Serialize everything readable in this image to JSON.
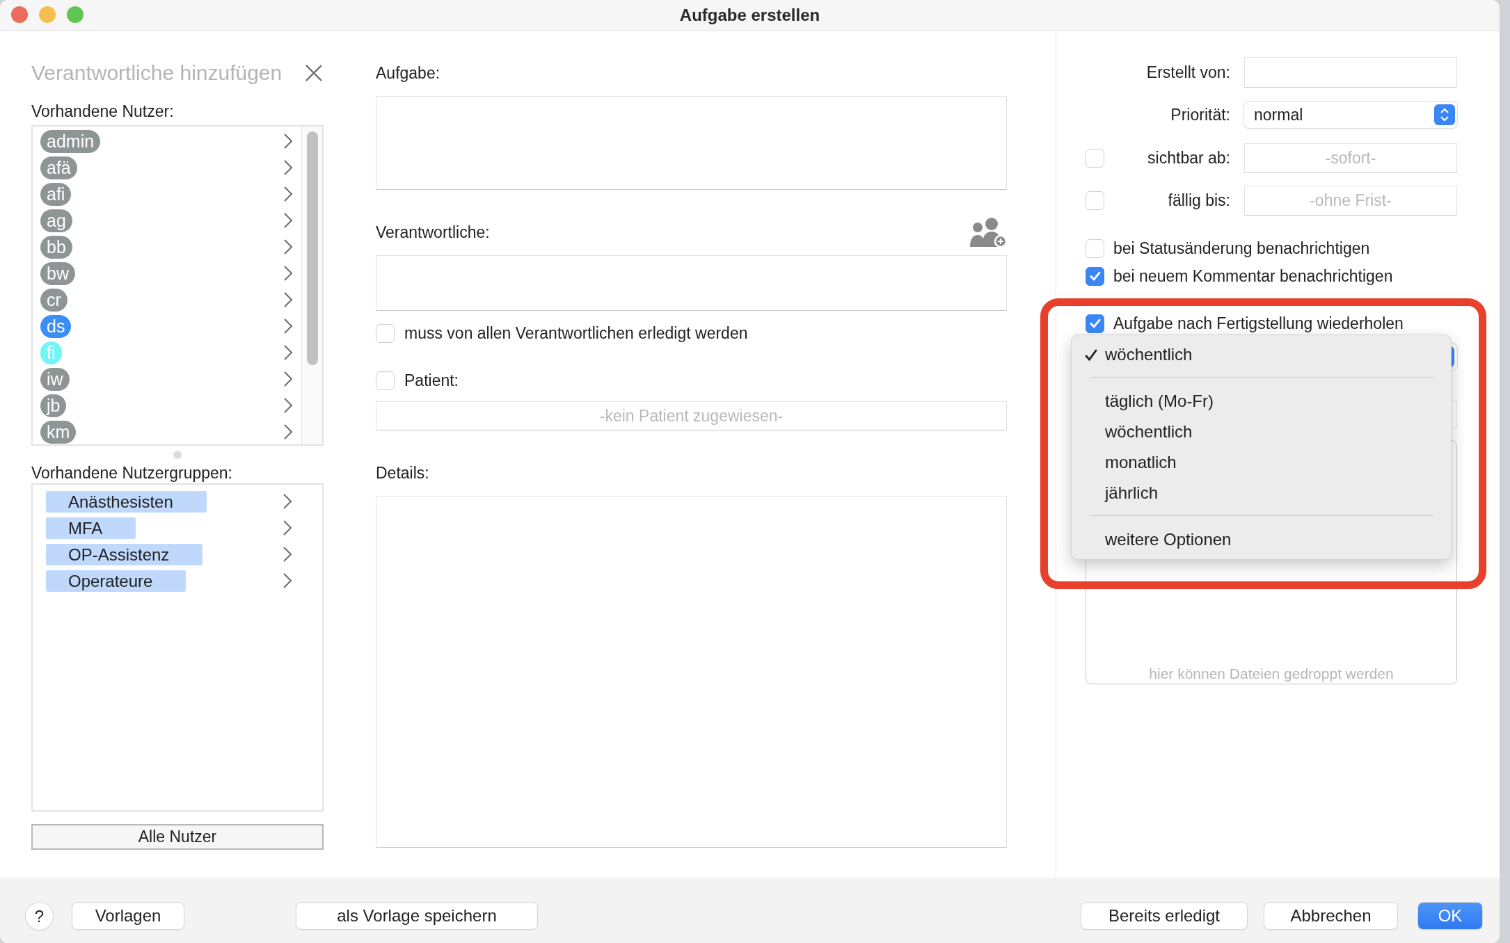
{
  "window": {
    "title": "Aufgabe erstellen"
  },
  "assignee_picker": {
    "title": "Verantwortliche hinzufügen",
    "users_label": "Vorhandene Nutzer:",
    "users": [
      {
        "name": "admin",
        "color": "#8e9595"
      },
      {
        "name": "afä",
        "color": "#8e9595"
      },
      {
        "name": "afi",
        "color": "#8e9595"
      },
      {
        "name": "ag",
        "color": "#8e9595"
      },
      {
        "name": "bb",
        "color": "#8e9595"
      },
      {
        "name": "bw",
        "color": "#8e9595"
      },
      {
        "name": "cr",
        "color": "#8e9595"
      },
      {
        "name": "ds",
        "color": "#3d8ef2"
      },
      {
        "name": "fi",
        "color": "#72f5f7"
      },
      {
        "name": "iw",
        "color": "#8e9595"
      },
      {
        "name": "jb",
        "color": "#8e9595"
      },
      {
        "name": "km",
        "color": "#8e9595"
      }
    ],
    "groups_label": "Vorhandene Nutzergruppen:",
    "groups": [
      {
        "name": "Anästhesisten"
      },
      {
        "name": "MFA"
      },
      {
        "name": "OP-Assistenz"
      },
      {
        "name": "Operateure"
      }
    ],
    "all_users_button": "Alle Nutzer"
  },
  "task_form": {
    "task_label": "Aufgabe:",
    "assignees_label": "Verantwortliche:",
    "all_must_complete": {
      "label": "muss von allen Verantwortlichen erledigt werden",
      "checked": false
    },
    "patient": {
      "label": "Patient:",
      "checked": false,
      "placeholder": "-kein Patient zugewiesen-"
    },
    "details_label": "Details:"
  },
  "options": {
    "created_by": {
      "label": "Erstellt von:"
    },
    "priority": {
      "label": "Priorität:",
      "value": "normal"
    },
    "visible_from": {
      "label": "sichtbar ab:",
      "checked": false,
      "placeholder": "-sofort-"
    },
    "due_until": {
      "label": "fällig bis:",
      "checked": false,
      "placeholder": "-ohne Frist-"
    },
    "notifications": [
      {
        "label": "bei Statusänderung benachrichtigen",
        "checked": false
      },
      {
        "label": "bei neuem Kommentar benachrichtigen",
        "checked": true
      }
    ],
    "repeat": {
      "label": "Aufgabe nach Fertigstellung wiederholen",
      "checked": true
    },
    "drop_zone": {
      "hint": "hier können Dateien gedroppt werden"
    }
  },
  "repeat_menu": {
    "items": [
      {
        "kind": "option",
        "label": "wöchentlich",
        "selected": true
      },
      {
        "kind": "separator"
      },
      {
        "kind": "option",
        "label": "täglich (Mo-Fr)",
        "selected": false
      },
      {
        "kind": "option",
        "label": "wöchentlich",
        "selected": false
      },
      {
        "kind": "option",
        "label": "monatlich",
        "selected": false
      },
      {
        "kind": "option",
        "label": "jährlich",
        "selected": false
      },
      {
        "kind": "separator"
      },
      {
        "kind": "option",
        "label": "weitere Optionen",
        "selected": false
      }
    ]
  },
  "footer": {
    "buttons": [
      {
        "kind": "help",
        "label": "?"
      },
      {
        "kind": "normal",
        "label": "Vorlagen"
      },
      {
        "kind": "normal",
        "label": "als Vorlage speichern"
      },
      {
        "kind": "normal",
        "label": "Bereits erledigt"
      },
      {
        "kind": "normal",
        "label": "Abbrechen"
      },
      {
        "kind": "default",
        "label": "OK"
      }
    ]
  }
}
